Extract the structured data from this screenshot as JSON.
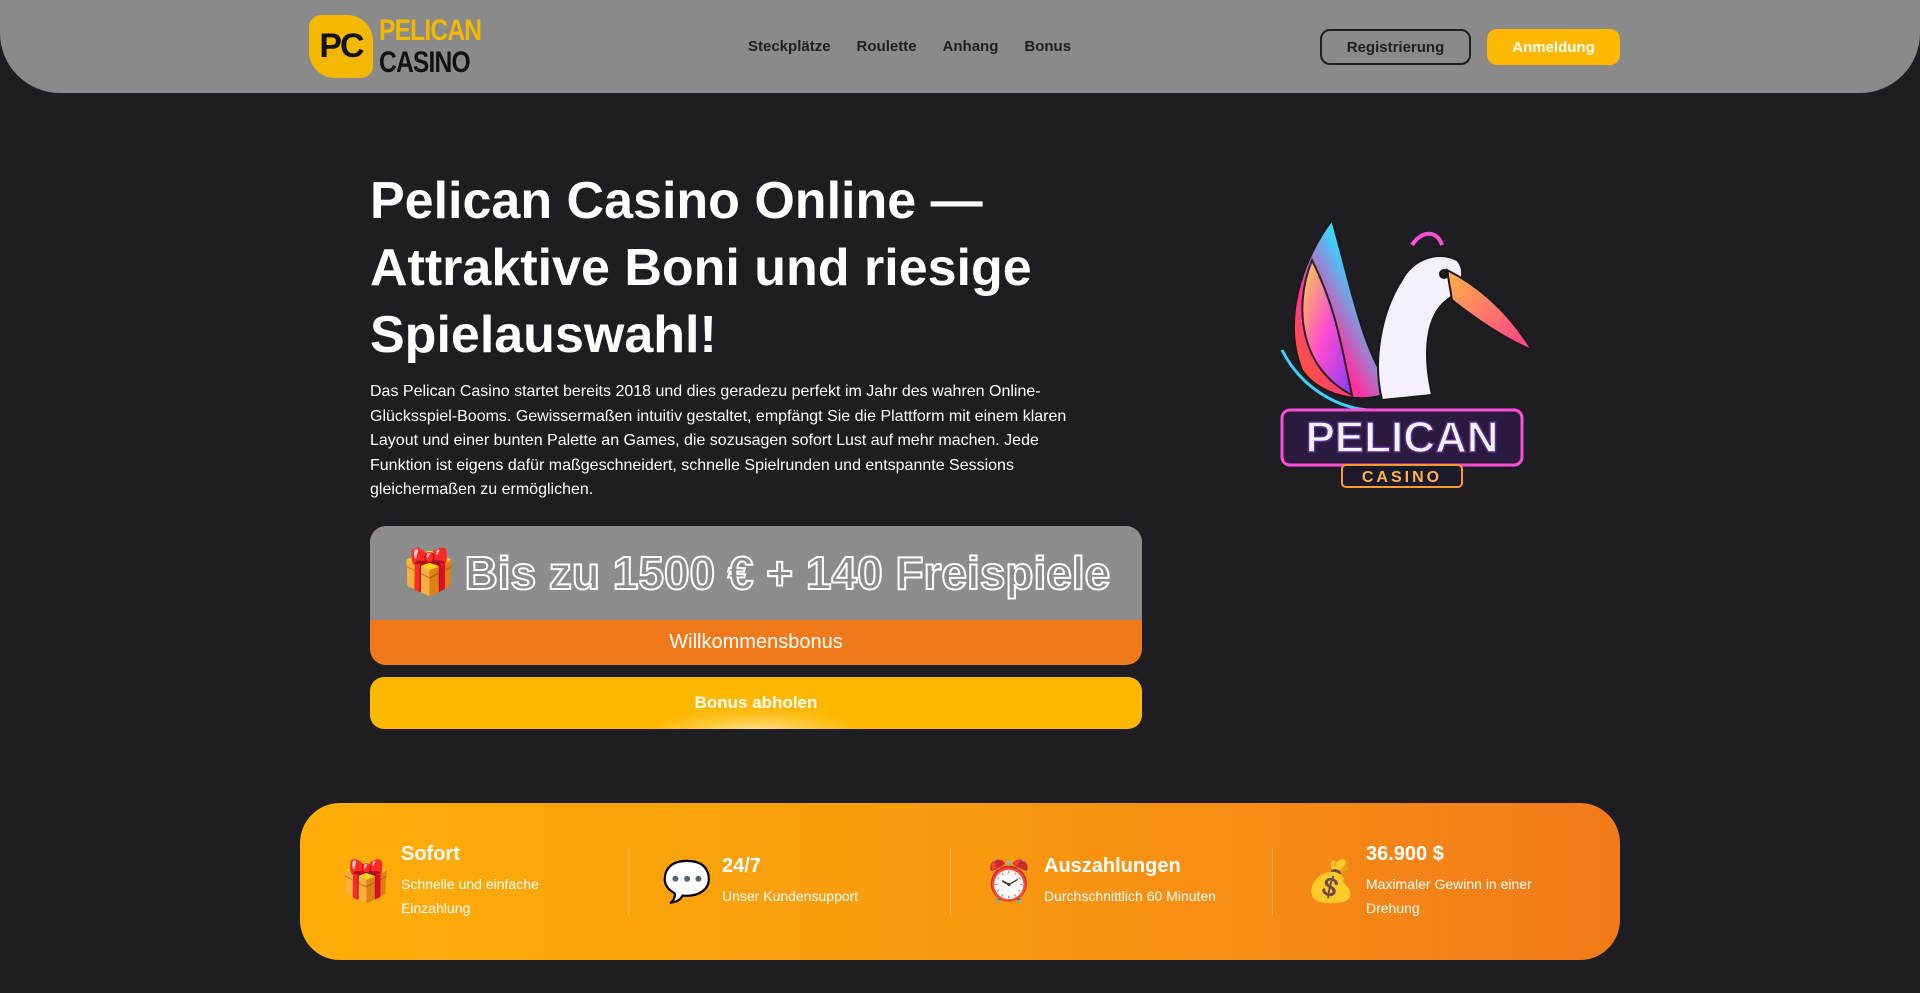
{
  "header": {
    "logo_badge": "PC",
    "logo_line1": "PELICAN",
    "logo_line2": "CASINO",
    "nav": [
      "Steckplätze",
      "Roulette",
      "Anhang",
      "Bonus"
    ],
    "register_label": "Registrierung",
    "login_label": "Anmeldung"
  },
  "hero": {
    "title": "Pelican Casino Online — Attraktive Boni und riesige Spielauswahl!",
    "text": "Das Pelican Casino startet bereits 2018 und dies geradezu perfekt im Jahr des wahren Online-Glücksspiel-Booms. Gewissermaßen intuitiv gestaltet, empfängt Sie die Plattform mit einem klaren Layout und einer bunten Palette an Games, die sozusagen sofort Lust auf mehr machen. Jede Funktion ist eigens dafür maßgeschneidert, schnelle Spielrunden und entspannte Sessions gleichermaßen zu ermöglichen.",
    "bonus_headline": "Bis zu 1500 € + 140 Freispiele",
    "bonus_sub": "Willkommensbonus",
    "claim_label": "Bonus abholen",
    "mascot_word": "PELICAN",
    "mascot_sub": "CASINO"
  },
  "stats": [
    {
      "icon": "gift-icon",
      "title": "Sofort",
      "desc": "Schnelle und einfache Einzahlung"
    },
    {
      "icon": "chat-icon",
      "title": "24/7",
      "desc": "Unser Kundensupport"
    },
    {
      "icon": "alarm-clock-icon",
      "title": "Auszahlungen",
      "desc": "Durchschnittlich 60 Minuten"
    },
    {
      "icon": "coin-stack-icon",
      "title": "36.900 $",
      "desc": "Maximaler Gewinn in einer Drehung"
    }
  ],
  "colors": {
    "accent": "#ffb800",
    "orange": "#f07a1a",
    "header_bg": "#8a8a8a",
    "page_bg": "#1e1d22"
  }
}
